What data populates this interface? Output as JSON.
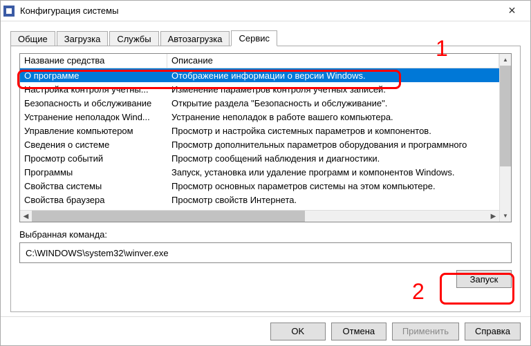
{
  "window": {
    "title": "Конфигурация системы"
  },
  "tabs": [
    "Общие",
    "Загрузка",
    "Службы",
    "Автозагрузка",
    "Сервис"
  ],
  "active_tab": 4,
  "headers": {
    "name": "Название средства",
    "desc": "Описание"
  },
  "rows": [
    {
      "name": "О программе",
      "desc": "Отображение информации о версии Windows.",
      "selected": true
    },
    {
      "name": "Настройка контроля учетны...",
      "desc": "Изменение параметров контроля учетных записей."
    },
    {
      "name": "Безопасность и обслуживание",
      "desc": "Открытие раздела \"Безопасность и обслуживание\"."
    },
    {
      "name": "Устранение неполадок Wind...",
      "desc": "Устранение неполадок в работе вашего компьютера."
    },
    {
      "name": "Управление компьютером",
      "desc": "Просмотр и настройка системных параметров и компонентов."
    },
    {
      "name": "Сведения о системе",
      "desc": "Просмотр дополнительных параметров оборудования и программного"
    },
    {
      "name": "Просмотр событий",
      "desc": "Просмотр сообщений наблюдения и диагностики."
    },
    {
      "name": "Программы",
      "desc": "Запуск, установка или удаление программ и компонентов Windows."
    },
    {
      "name": "Свойства системы",
      "desc": "Просмотр основных параметров системы на этом компьютере."
    },
    {
      "name": "Свойства браузера",
      "desc": "Просмотр свойств Интернета."
    }
  ],
  "selected_command_label": "Выбранная команда:",
  "selected_command": "C:\\WINDOWS\\system32\\winver.exe",
  "launch_label": "Запуск",
  "buttons": {
    "ok": "OK",
    "cancel": "Отмена",
    "apply": "Применить",
    "help": "Справка"
  },
  "annotations": {
    "a1": "1",
    "a2": "2"
  }
}
